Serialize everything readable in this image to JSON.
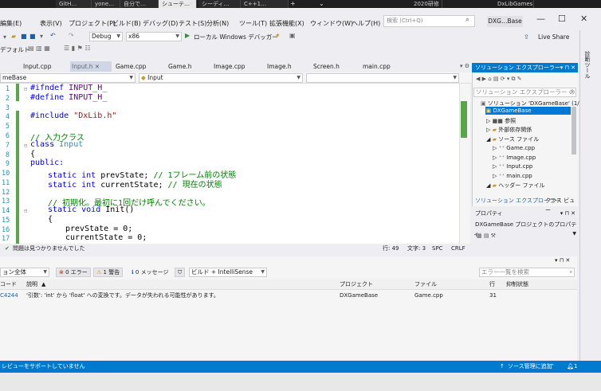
{
  "taskbar": {
    "items": [
      "GitH…",
      "yone…",
      "自分で…",
      "シューテ…",
      "シーディ…",
      "C++1…"
    ],
    "right_items": [
      "2020研修",
      "DxLibGames"
    ]
  },
  "menubar": {
    "items": [
      "編集(E)",
      "表示(V)",
      "プロジェクト(P)",
      "ビルド(B)",
      "デバッグ(D)",
      "テスト(S)",
      "分析(N)",
      "ツール(T)",
      "拡張機能(X)",
      "ウィンドウ(W)",
      "ヘルプ(H)"
    ],
    "search_placeholder": "検索 (Ctrl+Q)",
    "project_name": "DXG…Base",
    "live_share": "Live Share"
  },
  "toolbar": {
    "config": "Debug",
    "platform": "x86",
    "run_label": "ローカル Windows デバッガー",
    "default_label": "デフォルト"
  },
  "tabs": [
    "Input.cpp",
    "Input.h",
    "Game.cpp",
    "Game.h",
    "Image.cpp",
    "Image.h",
    "Screen.h",
    "main.cpp"
  ],
  "navbar": {
    "project": "meBase",
    "scope": "Input"
  },
  "editor": {
    "line_numbers": [
      "1",
      "2",
      "3",
      "4",
      "5",
      "6",
      "7",
      "8",
      "9",
      "10",
      "11",
      "12",
      "13",
      "14",
      "15",
      "16",
      "17"
    ],
    "lines": {
      "l1_a": "#ifndef",
      "l1_b": " INPUT_H_",
      "l2_a": "#define",
      "l2_b": " INPUT_H_",
      "l4_a": "#include",
      "l4_b": " \"DxLib.h\"",
      "l6": "// 入力クラス",
      "l7_a": "class",
      "l7_b": " Input",
      "l8": "{",
      "l9": "public:",
      "l10_a": "static int",
      "l10_b": " prevState;",
      "l10_c": " // 1フレーム前の状態",
      "l11_a": "static int",
      "l11_b": " currentState;",
      "l11_c": " // 現在の状態",
      "l13": "// 初期化。最初に1回だけ呼んでください。",
      "l14_a": "static void",
      "l14_b": " Init()",
      "l15": "{",
      "l16": "prevState = 0;",
      "l17": "currentState = 0;"
    }
  },
  "editor_status": {
    "issues": "問題は見つかりませんでした",
    "line": "行: 49",
    "col": "文字: 3",
    "spc": "SPC",
    "crlf": "CRLF"
  },
  "errorlist": {
    "scope": "ョン全体",
    "errors": "0 エラー",
    "warnings": "1 警告",
    "messages": "0 メッセージ",
    "build_filter": "ビルド + IntelliSense",
    "search_placeholder": "エラー一覧を検索",
    "headers": [
      "コード",
      "説明",
      "プロジェクト",
      "ファイル",
      "行",
      "抑制状態"
    ],
    "rows": [
      {
        "code": "C4244",
        "desc": "'引数': 'int' から 'float' への変換です。データが失われる可能性があります。",
        "project": "DXGameBase",
        "file": "Game.cpp",
        "line": "31",
        "suppress": ""
      }
    ]
  },
  "statusbar": {
    "left": "レビューをサポートしていません",
    "right": "ソース管理に追加",
    "badge": "1"
  },
  "solution_explorer": {
    "title": "ソリューション エクスプローラー",
    "search_placeholder": "ソリューション エクスプローラー の検索 (",
    "items": [
      "ソリューション 'DXGameBase' (1/1",
      "DXGameBase",
      "参照",
      "外部依存関係",
      "ソース ファイル",
      "Game.cpp",
      "Image.cpp",
      "Input.cpp",
      "main.cpp",
      "ヘッダー ファイル"
    ],
    "bottom_tabs": [
      "ソリューション エクスプローラー",
      "クラス ビュー"
    ]
  },
  "properties": {
    "title": "プロパティ",
    "combo": "DXGameBase プロジェクトのプロパティ"
  },
  "right_strip": {
    "label": "診断ツール"
  }
}
